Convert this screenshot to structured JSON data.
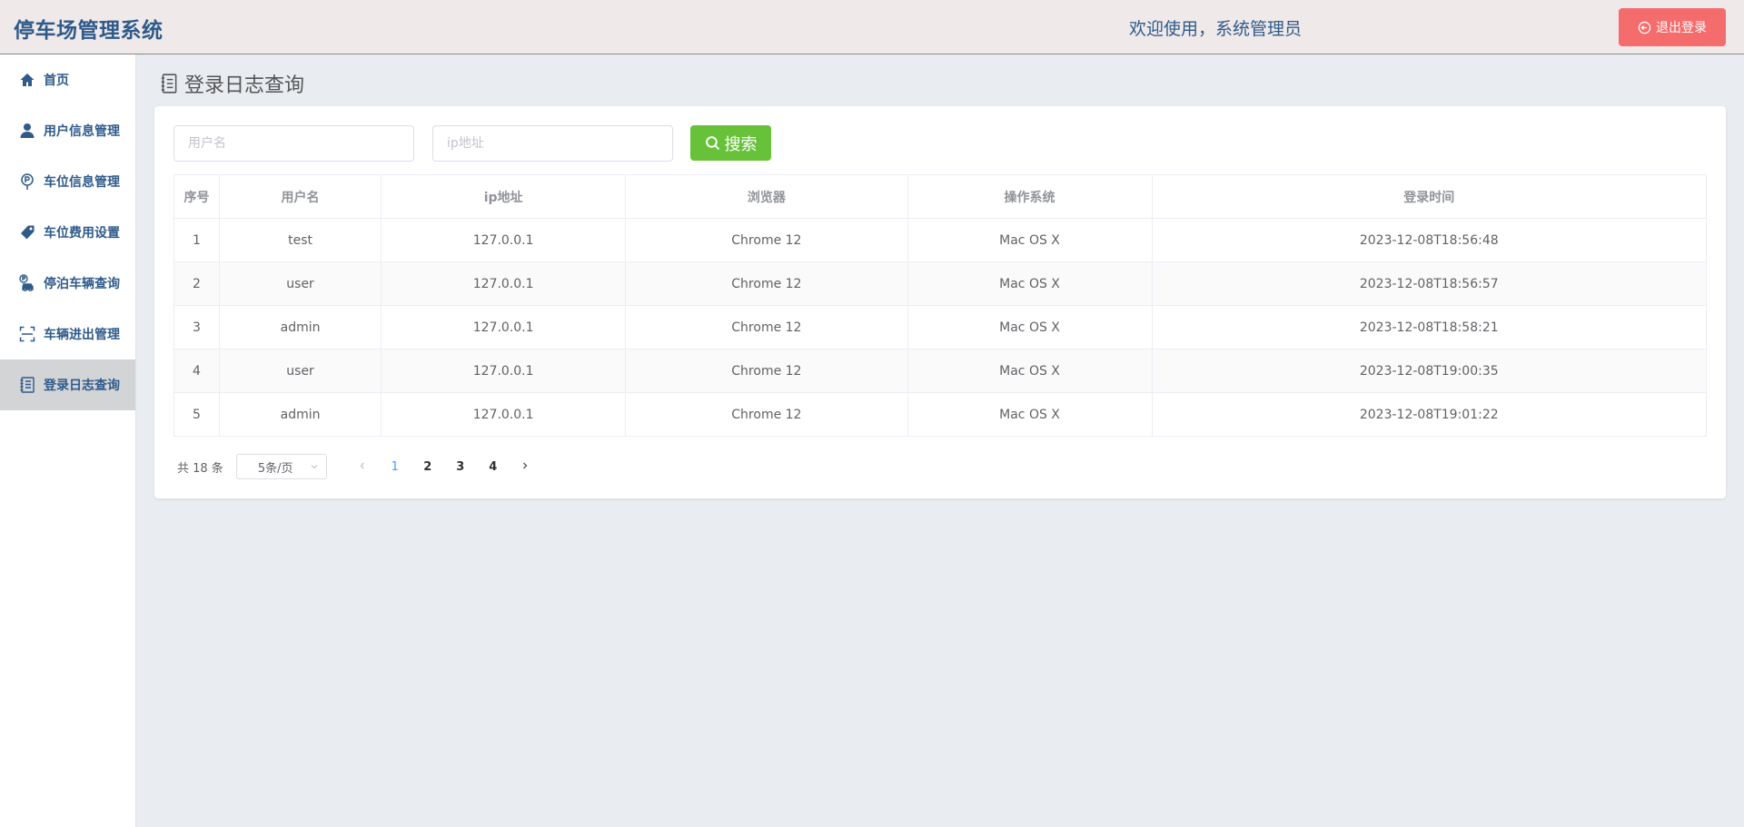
{
  "header": {
    "app_title": "停车场管理系统",
    "welcome": "欢迎使用，系统管理员",
    "logout_label": "退出登录"
  },
  "sidebar": {
    "items": [
      {
        "label": "首页",
        "icon": "home-icon"
      },
      {
        "label": "用户信息管理",
        "icon": "user-icon"
      },
      {
        "label": "车位信息管理",
        "icon": "parking-icon"
      },
      {
        "label": "车位费用设置",
        "icon": "price-tag-icon"
      },
      {
        "label": "停泊车辆查询",
        "icon": "parked-car-icon"
      },
      {
        "label": "车辆进出管理",
        "icon": "scan-icon"
      },
      {
        "label": "登录日志查询",
        "icon": "notebook-icon"
      }
    ],
    "active_index": 6
  },
  "page": {
    "title": "登录日志查询"
  },
  "search": {
    "username_placeholder": "用户名",
    "ip_placeholder": "ip地址",
    "button_label": "搜索"
  },
  "table": {
    "columns": [
      "序号",
      "用户名",
      "ip地址",
      "浏览器",
      "操作系统",
      "登录时间"
    ],
    "rows": [
      [
        "1",
        "test",
        "127.0.0.1",
        "Chrome 12",
        "Mac OS X",
        "2023-12-08T18:56:48"
      ],
      [
        "2",
        "user",
        "127.0.0.1",
        "Chrome 12",
        "Mac OS X",
        "2023-12-08T18:56:57"
      ],
      [
        "3",
        "admin",
        "127.0.0.1",
        "Chrome 12",
        "Mac OS X",
        "2023-12-08T18:58:21"
      ],
      [
        "4",
        "user",
        "127.0.0.1",
        "Chrome 12",
        "Mac OS X",
        "2023-12-08T19:00:35"
      ],
      [
        "5",
        "admin",
        "127.0.0.1",
        "Chrome 12",
        "Mac OS X",
        "2023-12-08T19:01:22"
      ]
    ]
  },
  "pagination": {
    "total": "共 18 条",
    "page_size": "5条/页",
    "pages": [
      "1",
      "2",
      "3",
      "4"
    ],
    "current_page": "1"
  },
  "colors": {
    "brand": "#2f5a8a",
    "danger": "#f56c6c",
    "success": "#67c23a",
    "primary": "#409eff"
  }
}
